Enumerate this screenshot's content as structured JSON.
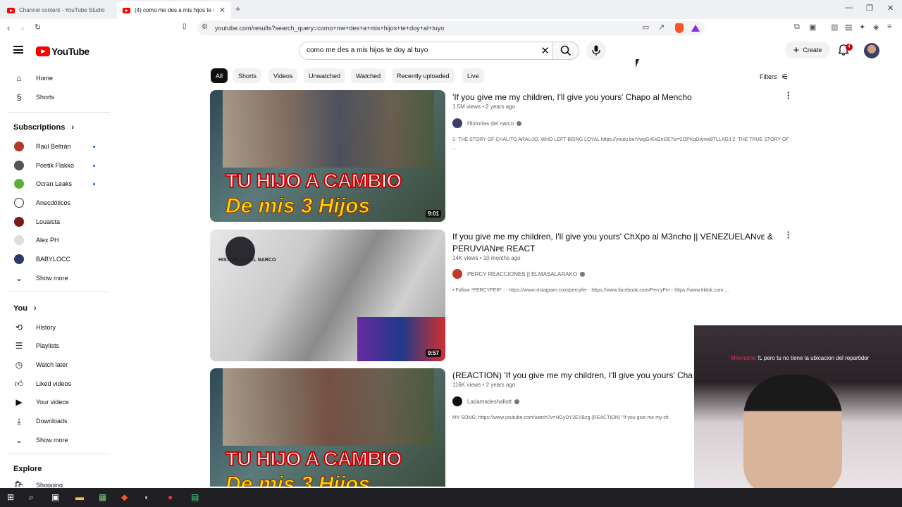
{
  "browser": {
    "tabs": [
      {
        "title": "Channel content - YouTube Studio"
      },
      {
        "title": "(4) como me des a mis hijos te d"
      }
    ],
    "url": "youtube.com/results?search_query=como+me+des+a+mis+hijos+te+doy+al+tuyo"
  },
  "header": {
    "logo_text": "YouTube",
    "search_value": "como me des a mis hijos te doy al tuyo",
    "create_label": "Create",
    "notifications_count": "4"
  },
  "sidebar": {
    "main": [
      {
        "label": "Home",
        "icon": "home-icon"
      },
      {
        "label": "Shorts",
        "icon": "shorts-icon"
      }
    ],
    "subscriptions_title": "Subscriptions",
    "subscriptions": [
      {
        "label": "Raúl Beltrán",
        "color": "#b23a2a"
      },
      {
        "label": "Poetik Flakko",
        "color": "#555555"
      },
      {
        "label": "Ocran Leaks",
        "color": "#5fae3c"
      },
      {
        "label": "Anecdóticos",
        "color": "#ffffff"
      },
      {
        "label": "Louaista",
        "color": "#7a1a1a"
      },
      {
        "label": "Alex PH",
        "color": "#dddddd"
      },
      {
        "label": "BABYLOCC",
        "color": "#2a3b6b"
      }
    ],
    "show_more": "Show more",
    "you_title": "You",
    "you_items": [
      {
        "label": "History",
        "icon": "history-icon"
      },
      {
        "label": "Playlists",
        "icon": "playlists-icon"
      },
      {
        "label": "Watch later",
        "icon": "watch-later-icon"
      },
      {
        "label": "Liked videos",
        "icon": "like-icon"
      },
      {
        "label": "Your videos",
        "icon": "your-videos-icon"
      },
      {
        "label": "Downloads",
        "icon": "download-icon"
      }
    ],
    "show_more_2": "Show more",
    "explore_title": "Explore",
    "explore_items": [
      {
        "label": "Shopping"
      }
    ]
  },
  "chips": [
    "All",
    "Shorts",
    "Videos",
    "Unwatched",
    "Watched",
    "Recently uploaded",
    "Live"
  ],
  "filters_label": "Filters",
  "results": [
    {
      "title": "'If you give me my children, I'll give you yours' Chapo al Mencho",
      "meta": "1.5M views • 2 years ago",
      "channel": "Historias del narco",
      "desc": "1- THE STORY OF CHALITO ARAUJO, WHO LEFT BEING LOYAL https://youtu.be/VwgGrKkGnGE?si=2OPKqDAmw8TLLAGJ 2- THE TRUE STORY OF ...",
      "duration": "9:01",
      "thumb_line1": "TU HIJO A CAMBIO",
      "thumb_line2": "De mis 3 Hijos"
    },
    {
      "title": "If you give me my children, I'll give you yours' ChXpo al M3ncho || VENEZUELANᴠᴇ & PERUVIANᴘᴇ REACT",
      "meta": "14K views • 10 months ago",
      "channel": "PERCY REACCIONES || ELMASALARAKO",
      "desc": "• Follow *PERCYFER* : - https://www.instagram.com/percyfer - https://www.facebook.com/PercyFer - https://www.tiktok.com ...",
      "duration": "9:57",
      "thumb_logo_text": "HISTORIAS DEL NARCO"
    },
    {
      "title": "(REACTION) 'If you give me my children, I'll give you yours' Chapo",
      "meta": "116K views • 2 years ago",
      "channel": "Ladamadeshallott",
      "desc": "MY SONG: https://www.youtube.com/watch?v=HGyDY3EYBzg (REACTION) \"If you give me my ch",
      "thumb_line1": "TU HIJO A CAMBIO",
      "thumb_line2": "De mis 3 Hijos"
    }
  ],
  "overlay": {
    "name": "Mfernpme",
    "message": "!L pero tu no tiene la ubicacion del repartidor"
  }
}
